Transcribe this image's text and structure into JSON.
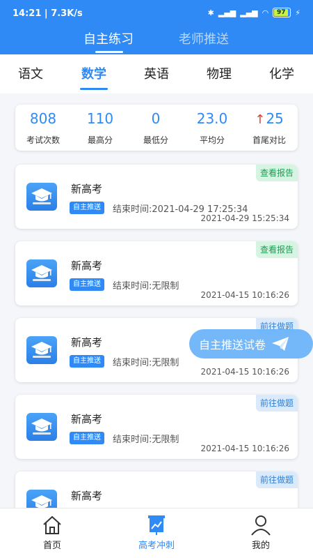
{
  "status_bar": {
    "time": "14:21",
    "speed": "7.3K/s",
    "battery": "97"
  },
  "top_tabs": [
    {
      "label": "自主练习",
      "active": true
    },
    {
      "label": "老师推送",
      "active": false
    }
  ],
  "subjects": [
    {
      "label": "语文",
      "active": false
    },
    {
      "label": "数学",
      "active": true
    },
    {
      "label": "英语",
      "active": false
    },
    {
      "label": "物理",
      "active": false
    },
    {
      "label": "化学",
      "active": false
    }
  ],
  "stats": [
    {
      "value": "808",
      "label": "考试次数"
    },
    {
      "value": "110",
      "label": "最高分"
    },
    {
      "value": "0",
      "label": "最低分"
    },
    {
      "value": "23.0",
      "label": "平均分"
    },
    {
      "value": "25",
      "label": "首尾对比"
    }
  ],
  "exams": [
    {
      "title": "新高考",
      "badge": "自主推送",
      "end": "结束时间:2021-04-29 17:25:34",
      "date": "2021-04-29 15:25:34",
      "action": "查看报告"
    },
    {
      "title": "新高考",
      "badge": "自主推送",
      "end": "结束时间:无限制",
      "date": "2021-04-15 10:16:26",
      "action": "查看报告"
    },
    {
      "title": "新高考",
      "badge": "自主推送",
      "end": "结束时间:无限制",
      "date": "2021-04-15 10:16:26",
      "action": "前往做题"
    },
    {
      "title": "新高考",
      "badge": "自主推送",
      "end": "结束时间:无限制",
      "date": "2021-04-15 10:16:26",
      "action": "前往做题"
    },
    {
      "title": "新高考",
      "badge": "自主推送",
      "end": "",
      "date": "",
      "action": "前往做题"
    }
  ],
  "float_button": {
    "label": "自主推送试卷"
  },
  "bottom_nav": [
    {
      "label": "首页",
      "icon": "home-icon",
      "active": false
    },
    {
      "label": "高考冲刺",
      "icon": "chart-board-icon",
      "active": true
    },
    {
      "label": "我的",
      "icon": "user-icon",
      "active": false
    }
  ],
  "colors": {
    "primary": "#2f8af5",
    "report_bg": "#d6f4e2",
    "report_text": "#1f9a55",
    "goto_bg": "#dbeafb",
    "goto_text": "#2f7fd4"
  }
}
